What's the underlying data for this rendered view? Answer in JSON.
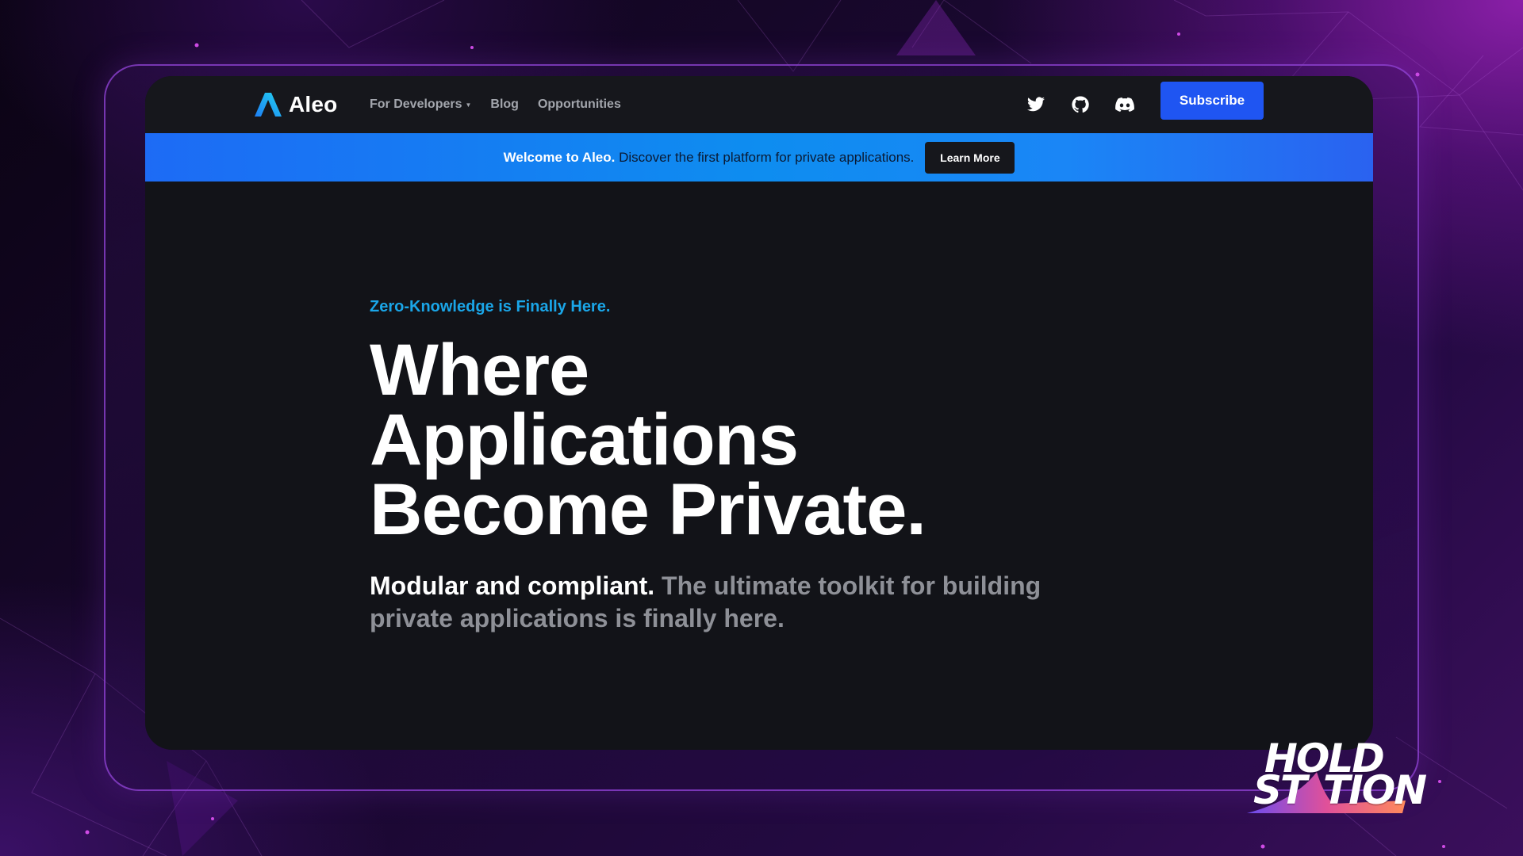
{
  "nav": {
    "logo_text": "Aleo",
    "links": [
      {
        "label": "For Developers",
        "has_dropdown": true
      },
      {
        "label": "Blog"
      },
      {
        "label": "Opportunities"
      }
    ],
    "social_icons": [
      "twitter-icon",
      "github-icon",
      "discord-icon"
    ],
    "subscribe_label": "Subscribe"
  },
  "banner": {
    "strong": "Welcome to Aleo.",
    "text": "Discover the first platform for private applications.",
    "button_label": "Learn More"
  },
  "hero": {
    "eyebrow": "Zero-Knowledge is Finally Here.",
    "headline_lines": [
      "Where",
      "Applications",
      "Become Private."
    ],
    "sub_strong": "Modular and compliant.",
    "sub_rest": "The ultimate toolkit for building private applications is finally here."
  },
  "watermark": {
    "line1": "HOLD",
    "line2": "ST",
    "line3": "TION"
  },
  "colors": {
    "accent_blue": "#1f55f2",
    "eyebrow_cyan": "#1aa6e8",
    "site_bg": "#121318",
    "frame_purple": "#9646dc"
  }
}
